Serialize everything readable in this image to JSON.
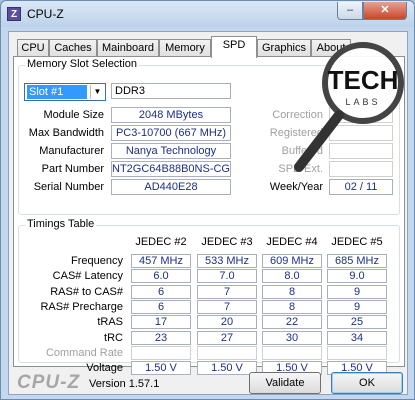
{
  "window": {
    "title": "CPU-Z",
    "app_icon_letter": "Z",
    "minimize_glyph": "–",
    "close_glyph": "✕"
  },
  "tabs": [
    {
      "label": "CPU",
      "active": false
    },
    {
      "label": "Caches",
      "active": false
    },
    {
      "label": "Mainboard",
      "active": false
    },
    {
      "label": "Memory",
      "active": false
    },
    {
      "label": "SPD",
      "active": true
    },
    {
      "label": "Graphics",
      "active": false
    },
    {
      "label": "About",
      "active": false
    }
  ],
  "memory_slot": {
    "group_title": "Memory Slot Selection",
    "slot_selected": "Slot #1",
    "memory_type": "DDR3",
    "fields": {
      "module_size": {
        "label": "Module Size",
        "value": "2048 MBytes"
      },
      "max_bandwidth": {
        "label": "Max Bandwidth",
        "value": "PC3-10700 (667 MHz)"
      },
      "manufacturer": {
        "label": "Manufacturer",
        "value": "Nanya Technology"
      },
      "part_number": {
        "label": "Part Number",
        "value": "NT2GC64B88B0NS-CG"
      },
      "serial_number": {
        "label": "Serial Number",
        "value": "AD440E28"
      }
    },
    "right_fields": {
      "correction": "Correction",
      "registered": "Registered",
      "buffered": "Buffered",
      "spd_ext": "SPD Ext.",
      "week_year_label": "Week/Year",
      "week_year_value": "02 / 11"
    }
  },
  "timings": {
    "group_title": "Timings Table",
    "columns": [
      "JEDEC #2",
      "JEDEC #3",
      "JEDEC #4",
      "JEDEC #5"
    ],
    "rows": [
      {
        "label": "Frequency",
        "values": [
          "457 MHz",
          "533 MHz",
          "609 MHz",
          "685 MHz"
        ],
        "dim": false
      },
      {
        "label": "CAS# Latency",
        "values": [
          "6.0",
          "7.0",
          "8.0",
          "9.0"
        ],
        "dim": false
      },
      {
        "label": "RAS# to CAS#",
        "values": [
          "6",
          "7",
          "8",
          "9"
        ],
        "dim": false
      },
      {
        "label": "RAS# Precharge",
        "values": [
          "6",
          "7",
          "8",
          "9"
        ],
        "dim": false
      },
      {
        "label": "tRAS",
        "values": [
          "17",
          "20",
          "22",
          "25"
        ],
        "dim": false
      },
      {
        "label": "tRC",
        "values": [
          "23",
          "27",
          "30",
          "34"
        ],
        "dim": false
      },
      {
        "label": "Command Rate",
        "values": [
          "",
          "",
          "",
          ""
        ],
        "dim": true
      },
      {
        "label": "Voltage",
        "values": [
          "1.50 V",
          "1.50 V",
          "1.50 V",
          "1.50 V"
        ],
        "dim": false
      }
    ]
  },
  "footer": {
    "logo": "CPU-Z",
    "version": "Version 1.57.1",
    "validate_label": "Validate",
    "ok_label": "OK"
  },
  "watermark": {
    "brand_top": "TECH",
    "brand_bottom": "LABS"
  }
}
